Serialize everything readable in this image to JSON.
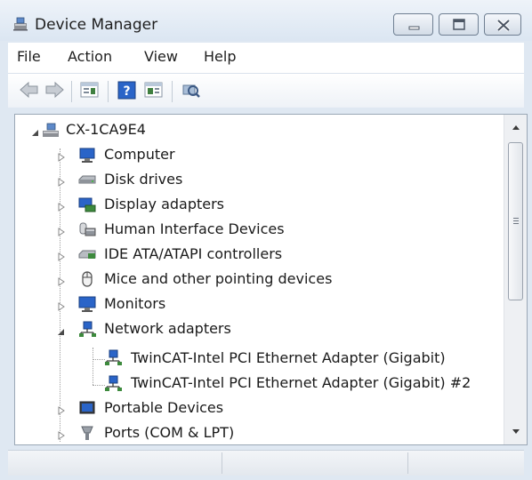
{
  "window": {
    "title": "Device Manager"
  },
  "menu": [
    "File",
    "Action",
    "View",
    "Help"
  ],
  "toolbar": {
    "buttons": [
      "back-arrow-icon",
      "forward-arrow-icon",
      "properties-icon",
      "help-icon",
      "update-driver-icon",
      "scan-hardware-icon"
    ]
  },
  "tree": {
    "root": {
      "label": "CX-1CA9E4",
      "expanded": true
    },
    "categories": [
      {
        "label": "Computer",
        "icon": "computer-icon",
        "expanded": false
      },
      {
        "label": "Disk drives",
        "icon": "disk-drive-icon",
        "expanded": false
      },
      {
        "label": "Display adapters",
        "icon": "display-adapter-icon",
        "expanded": false
      },
      {
        "label": "Human Interface Devices",
        "icon": "hid-icon",
        "expanded": false
      },
      {
        "label": "IDE ATA/ATAPI controllers",
        "icon": "ide-controller-icon",
        "expanded": false
      },
      {
        "label": "Mice and other pointing devices",
        "icon": "mouse-icon",
        "expanded": false
      },
      {
        "label": "Monitors",
        "icon": "monitor-icon",
        "expanded": false
      },
      {
        "label": "Network adapters",
        "icon": "network-adapter-icon",
        "expanded": true,
        "children": [
          {
            "label": "TwinCAT-Intel PCI Ethernet Adapter (Gigabit)",
            "icon": "network-adapter-icon"
          },
          {
            "label": "TwinCAT-Intel PCI Ethernet Adapter (Gigabit) #2",
            "icon": "network-adapter-icon"
          }
        ]
      },
      {
        "label": "Portable Devices",
        "icon": "portable-device-icon",
        "expanded": false
      },
      {
        "label": "Ports (COM & LPT)",
        "icon": "port-icon",
        "expanded": false
      }
    ]
  },
  "colors": {
    "frame": "#dfe8f2",
    "accent_blue": "#2a64c8",
    "tree_line": "#a0a0a0"
  }
}
